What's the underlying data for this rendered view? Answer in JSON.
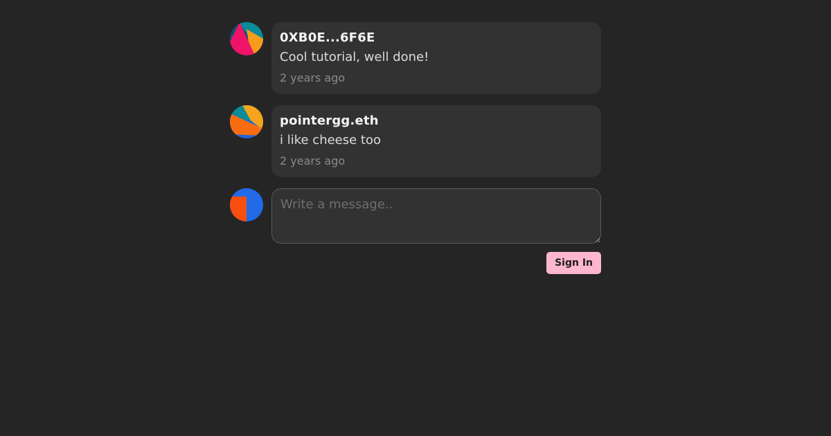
{
  "comments": [
    {
      "author": "0XB0E...6F6E",
      "text": "Cool tutorial, well done!",
      "time": "2 years ago",
      "avatar_colors": [
        "#0b4f6c",
        "#f0136a",
        "#f79b1c",
        "#0b8a98"
      ]
    },
    {
      "author": "pointergg.eth",
      "text": "i like cheese too",
      "time": "2 years ago",
      "avatar_colors": [
        "#0b8a98",
        "#f5a41c",
        "#f86d12",
        "#1f66d8"
      ]
    }
  ],
  "composer": {
    "placeholder": "Write a message..",
    "value": "",
    "avatar_colors": [
      "#216be8",
      "#f84e10"
    ]
  },
  "actions": {
    "signin_label": "Sign In"
  },
  "colors": {
    "background": "#252525",
    "bubble": "#323232",
    "accent": "#ffb7cd"
  }
}
